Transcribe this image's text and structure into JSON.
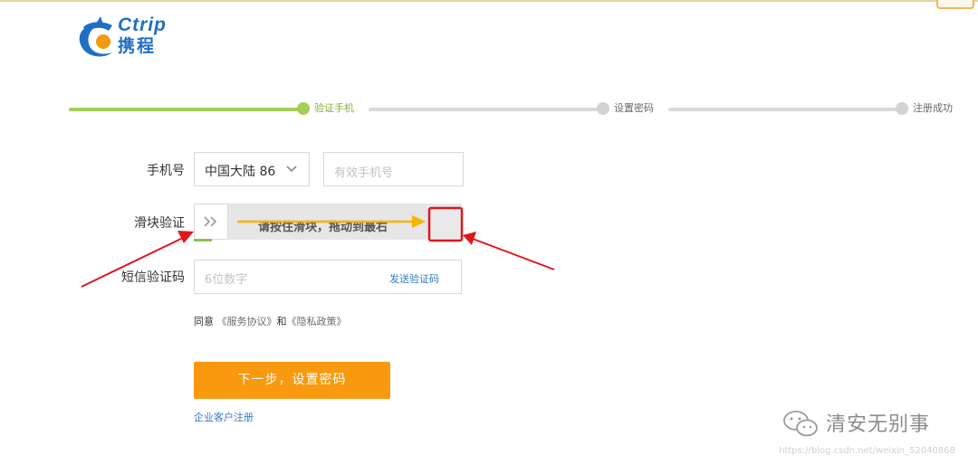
{
  "brand": {
    "name_en": "Ctrip",
    "name_cn": "携程",
    "color": "#1f6fc5"
  },
  "steps": [
    {
      "label": "验证手机",
      "state": "active"
    },
    {
      "label": "设置密码",
      "state": "pending"
    },
    {
      "label": "注册成功",
      "state": "pending"
    }
  ],
  "colors": {
    "progress_active": "#a3cf55",
    "progress_pending": "#d9d9d9",
    "accent_orange": "#f8990f",
    "link_blue": "#3679c6",
    "annotation_red": "#e0161d",
    "annotation_yellow": "#f6b400"
  },
  "form": {
    "phone_label": "手机号",
    "country_select": "中国大陆 86",
    "phone_placeholder": "有效手机号",
    "slider_label": "滑块验证",
    "slider_hint": "请按住滑块，拖动到最右",
    "sms_label": "短信验证码",
    "sms_placeholder": "6位数字",
    "send_code": "发送验证码"
  },
  "agreement": {
    "prefix": "同意",
    "service": "《服务协议》",
    "and": "和",
    "privacy": "《隐私政策》"
  },
  "next_button": "下一步，设置密码",
  "corporate_link": "企业客户注册",
  "watermark": {
    "account": "清安无别事",
    "url": "https://blog.csdn.net/weixin_52040868"
  },
  "icons": {
    "logo": "dolphin-logo",
    "dropdown": "chevron-down-icon",
    "slider": "double-chevron-right-icon",
    "wechat": "wechat-icon"
  }
}
